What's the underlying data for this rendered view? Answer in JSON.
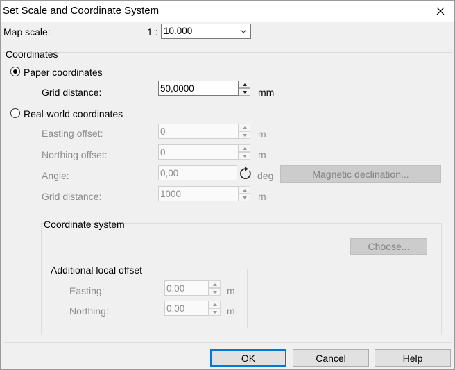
{
  "window": {
    "title": "Set Scale and Coordinate System",
    "close_icon": "close-icon"
  },
  "map_scale": {
    "label": "Map scale:",
    "prefix": "1 :",
    "value": "10.000"
  },
  "coordinates": {
    "group_label": "Coordinates",
    "paper": {
      "label": "Paper coordinates",
      "selected": true,
      "grid_distance_label": "Grid distance:",
      "grid_distance_value": "50,0000",
      "grid_distance_unit": "mm"
    },
    "real_world": {
      "label": "Real-world coordinates",
      "selected": false,
      "easting_offset_label": "Easting offset:",
      "easting_offset_value": "0",
      "easting_offset_unit": "m",
      "northing_offset_label": "Northing offset:",
      "northing_offset_value": "0",
      "northing_offset_unit": "m",
      "angle_label": "Angle:",
      "angle_value": "0,00",
      "angle_unit": "deg",
      "magnetic_button": "Magnetic declination...",
      "grid_distance_label": "Grid distance:",
      "grid_distance_value": "1000",
      "grid_distance_unit": "m"
    }
  },
  "coordinate_system": {
    "group_label": "Coordinate system",
    "choose_button": "Choose...",
    "local_offset": {
      "group_label": "Additional local offset",
      "easting_label": "Easting:",
      "easting_value": "0,00",
      "easting_unit": "m",
      "northing_label": "Northing:",
      "northing_value": "0,00",
      "northing_unit": "m"
    }
  },
  "buttons": {
    "ok": "OK",
    "cancel": "Cancel",
    "help": "Help"
  },
  "colors": {
    "dialog_bg": "#f0f0f0",
    "default_button_border": "#0078d7",
    "disabled_text": "#8c8c8c"
  }
}
